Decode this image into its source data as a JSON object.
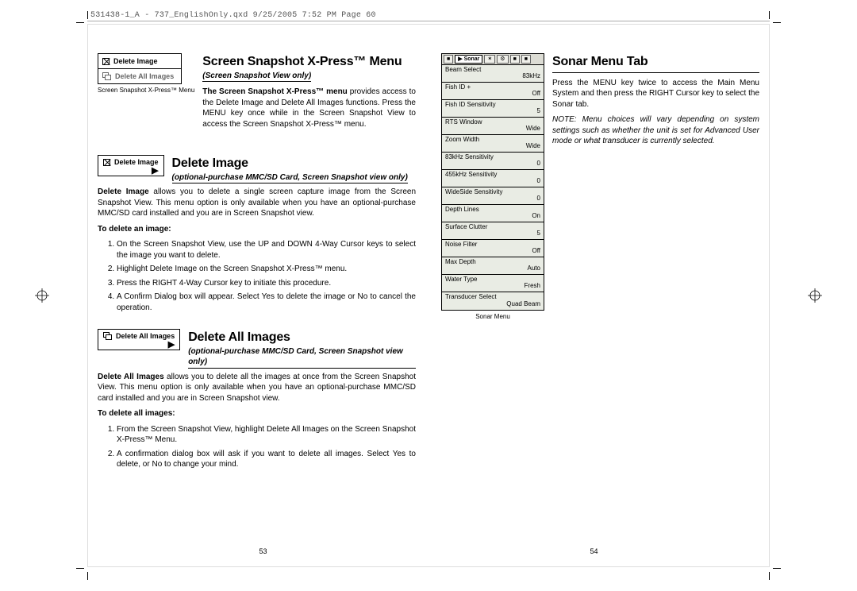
{
  "slug": "531438-1_A - 737_EnglishOnly.qxd  9/25/2005  7:52 PM  Page 60",
  "page_left": "53",
  "page_right": "54",
  "snapshot_box": {
    "r1": "Delete Image",
    "r2": "Delete All Images",
    "caption": "Screen Snapshot X-Press™ Menu"
  },
  "sec_xpress": {
    "title": "Screen Snapshot X-Press™ Menu",
    "sub": "(Screen Snapshot View only)",
    "body": "The Screen Snapshot X-Press™ menu provides access to the Delete Image and Delete All Images functions. Press the MENU key once while in the Screen Snapshot View to access the Screen Snapshot X-Press™ menu."
  },
  "sec_delete_image": {
    "box_label": "Delete Image",
    "title": "Delete Image",
    "sub": "(optional-purchase MMC/SD Card, Screen Snapshot view only)",
    "para": "Delete Image allows you to delete a single screen capture image from the Screen Snapshot View. This menu option is only available when you have an optional-purchase MMC/SD card installed and you are in Screen Snapshot view.",
    "how_label": "To delete an image:",
    "steps": [
      "On the Screen Snapshot View, use the UP and DOWN 4-Way Cursor keys to select the image you want to delete.",
      "Highlight Delete Image on the Screen Snapshot X-Press™ menu.",
      "Press the RIGHT 4-Way Cursor key to initiate this procedure.",
      "A Confirm Dialog box will appear. Select Yes to delete the image or No to cancel the operation."
    ]
  },
  "sec_delete_all": {
    "box_label": "Delete All Images",
    "title": "Delete All Images",
    "sub": "(optional-purchase MMC/SD Card, Screen Snapshot view only)",
    "para": "Delete All Images allows you to delete all the images at once from the Screen Snapshot View. This menu option is only available when you have an optional-purchase MMC/SD card installed and you are in Screen Snapshot view.",
    "how_label": "To delete all images:",
    "steps": [
      "From the Screen Snapshot View, highlight Delete All Images on the Screen Snapshot X-Press™ Menu.",
      "A confirmation dialog box will ask if you want to delete all images. Select Yes to delete, or No to change your mind."
    ]
  },
  "sec_sonar": {
    "title": "Sonar Menu Tab",
    "para": "Press the MENU key twice to access the Main Menu System and then press the RIGHT Cursor key to select the Sonar tab.",
    "note": "NOTE: Menu choices will vary depending on system settings such as whether the unit is set for Advanced User mode or what transducer is currently selected.",
    "caption": "Sonar Menu",
    "tabs": [
      "■",
      "▶ Sonar",
      "✶",
      "⚙",
      "■",
      "■"
    ],
    "rows": [
      {
        "k": "Beam Select",
        "v": "83kHz"
      },
      {
        "k": "Fish ID +",
        "v": "Off"
      },
      {
        "k": "Fish ID Sensitivity",
        "v": "5"
      },
      {
        "k": "RTS Window",
        "v": "Wide"
      },
      {
        "k": "Zoom Width",
        "v": "Wide"
      },
      {
        "k": "83kHz Sensitivity",
        "v": "0"
      },
      {
        "k": "455kHz Sensitivity",
        "v": "0"
      },
      {
        "k": "WideSide Sensitivity",
        "v": "0"
      },
      {
        "k": "Depth Lines",
        "v": "On"
      },
      {
        "k": "Surface Clutter",
        "v": "5"
      },
      {
        "k": "Noise Filter",
        "v": "Off"
      },
      {
        "k": "Max Depth",
        "v": "Auto"
      },
      {
        "k": "Water Type",
        "v": "Fresh"
      },
      {
        "k": "Transducer Select",
        "v": "Quad Beam"
      }
    ]
  }
}
